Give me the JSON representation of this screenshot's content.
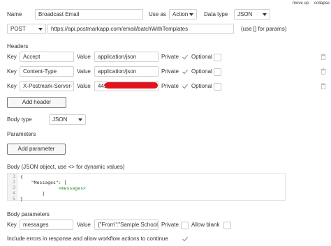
{
  "top_links": {
    "move_up": "move up",
    "collapse": "collapse"
  },
  "name_row": {
    "label": "Name",
    "value": "Broadcast Email",
    "use_as_label": "Use as",
    "use_as_value": "Action",
    "data_type_label": "Data type",
    "data_type_value": "JSON"
  },
  "request_row": {
    "method": "POST",
    "url": "https://api.postmarkapp.com/email/batchWithTemplates",
    "hint": "(use [] for params)"
  },
  "headers": {
    "title": "Headers",
    "key_label": "Key",
    "value_label": "Value",
    "private_label": "Private",
    "optional_label": "Optional",
    "rows": [
      {
        "key": "Accept",
        "value": "application/json",
        "private": true,
        "optional": false
      },
      {
        "key": "Content-Type",
        "value": "application/json",
        "private": true,
        "optional": false
      },
      {
        "key": "X-Postmark-Server-To",
        "value": "449",
        "private": true,
        "optional": false
      }
    ],
    "add_button": "Add header"
  },
  "body_type": {
    "label": "Body type",
    "value": "JSON"
  },
  "parameters": {
    "title": "Parameters",
    "add_button": "Add parameter"
  },
  "body_json": {
    "label": "Body (JSON object, use <> for dynamic values)",
    "line_numbers": [
      "1",
      "2",
      "3",
      "4",
      "5"
    ],
    "lines": [
      "{",
      "    \"Messages\": [",
      "",
      "        ]",
      "}"
    ],
    "dynamic_tag": "<messages>"
  },
  "body_parameters": {
    "title": "Body parameters",
    "key_label": "Key",
    "key_value": "messages",
    "value_label": "Value",
    "value_value": "{\"From\":\"Sample School <",
    "private_label": "Private",
    "private": false,
    "allow_blank_label": "Allow blank",
    "allow_blank": false
  },
  "include_errors": {
    "label": "Include errors in response and allow workflow actions to continue",
    "checked": true
  },
  "colors": {
    "redaction": "#e0141a",
    "check": "#8a8a8a",
    "json_tag": "#2a8a2a"
  }
}
